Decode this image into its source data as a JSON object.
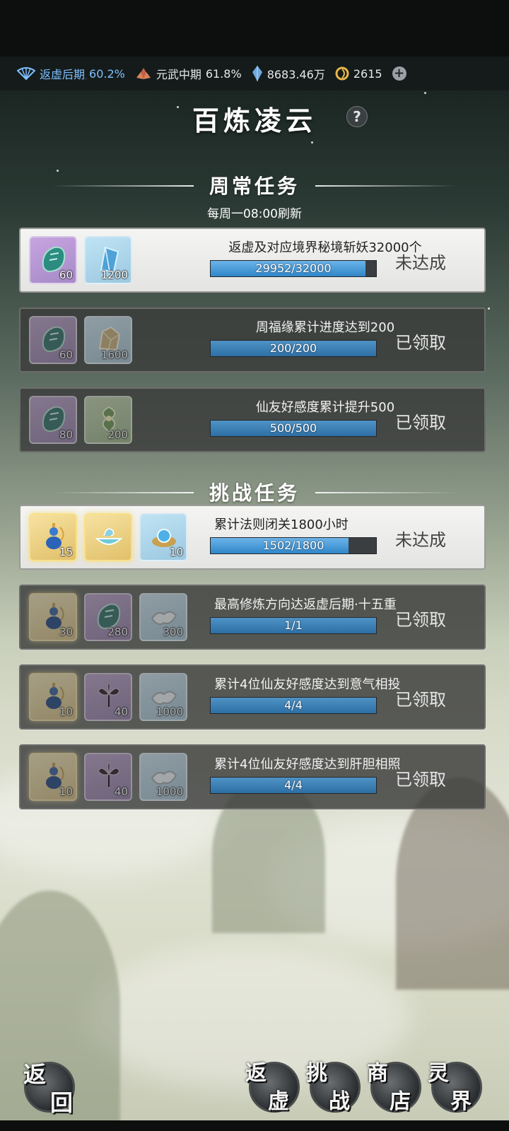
{
  "topbar": {
    "realm": {
      "label": "返虚后期",
      "pct": "60.2%"
    },
    "martial": {
      "label": "元武中期",
      "pct": "61.8%"
    },
    "spirit_stones": "8683.46万",
    "currency": "2615"
  },
  "title": "百炼凌云",
  "weekly": {
    "heading": "周常任务",
    "refresh": "每周一08:00刷新",
    "tasks": [
      {
        "desc": "返虚及对应境界秘境斩妖32000个",
        "progress_text": "29952/32000",
        "progress": 0.936,
        "status": "未达成",
        "state": "active",
        "rewards": [
          {
            "icon": "jade-slip-icon",
            "qty": "60",
            "tone": "purple"
          },
          {
            "icon": "spirit-crystal-icon",
            "qty": "1200",
            "tone": "blue"
          }
        ]
      },
      {
        "desc": "周福缘累计进度达到200",
        "progress_text": "200/200",
        "progress": 1.0,
        "status": "已领取",
        "state": "done",
        "rewards": [
          {
            "icon": "jade-slip-icon",
            "qty": "60",
            "tone": "purple"
          },
          {
            "icon": "gold-ore-icon",
            "qty": "1600",
            "tone": "blue"
          }
        ]
      },
      {
        "desc": "仙友好感度累计提升500",
        "progress_text": "500/500",
        "progress": 1.0,
        "status": "已领取",
        "state": "done",
        "rewards": [
          {
            "icon": "jade-slip-icon",
            "qty": "80",
            "tone": "purple"
          },
          {
            "icon": "swirl-leaf-icon",
            "qty": "200",
            "tone": "green"
          }
        ]
      }
    ]
  },
  "challenge": {
    "heading": "挑战任务",
    "tasks": [
      {
        "desc": "累计法则闭关1800小时",
        "progress_text": "1502/1800",
        "progress": 0.834,
        "status": "未达成",
        "state": "active",
        "rewards": [
          {
            "icon": "gourd-vase-icon",
            "qty": "15",
            "tone": "gold"
          },
          {
            "icon": "jade-bowl-icon",
            "qty": "",
            "tone": "gold"
          },
          {
            "icon": "spirit-pearl-icon",
            "qty": "10",
            "tone": "blue"
          }
        ]
      },
      {
        "desc": "最高修炼方向达返虚后期·十五重",
        "progress_text": "1/1",
        "progress": 1.0,
        "status": "已领取",
        "state": "done",
        "rewards": [
          {
            "icon": "gourd-vase-icon",
            "qty": "30",
            "tone": "gold"
          },
          {
            "icon": "jade-slip-icon",
            "qty": "280",
            "tone": "purple"
          },
          {
            "icon": "silk-cloth-icon",
            "qty": "300",
            "tone": "blue"
          }
        ]
      },
      {
        "desc": "累计4位仙友好感度达到意气相投",
        "progress_text": "4/4",
        "progress": 1.0,
        "status": "已领取",
        "state": "done",
        "rewards": [
          {
            "icon": "gourd-vase-icon",
            "qty": "10",
            "tone": "gold"
          },
          {
            "icon": "lotus-flower-icon",
            "qty": "40",
            "tone": "purple"
          },
          {
            "icon": "silk-cloth-icon",
            "qty": "1000",
            "tone": "blue"
          }
        ]
      },
      {
        "desc": "累计4位仙友好感度达到肝胆相照",
        "progress_text": "4/4",
        "progress": 1.0,
        "status": "已领取",
        "state": "done",
        "rewards": [
          {
            "icon": "gourd-vase-icon",
            "qty": "10",
            "tone": "gold"
          },
          {
            "icon": "lotus-flower-icon",
            "qty": "40",
            "tone": "purple"
          },
          {
            "icon": "silk-cloth-icon",
            "qty": "1000",
            "tone": "blue"
          }
        ]
      }
    ]
  },
  "nav": {
    "back": [
      "返",
      "回"
    ],
    "items": [
      [
        "返",
        "虚"
      ],
      [
        "挑",
        "战"
      ],
      [
        "商",
        "店"
      ],
      [
        "灵",
        "界"
      ]
    ]
  }
}
